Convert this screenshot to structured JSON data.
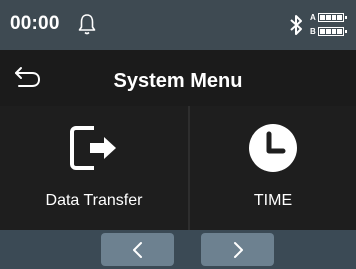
{
  "status_bar": {
    "time": "00:00",
    "icons": [
      "bell-icon",
      "bluetooth-icon",
      "battery-a-icon",
      "battery-b-icon"
    ],
    "battery_labels": [
      "A",
      "B"
    ]
  },
  "header": {
    "title": "System Menu",
    "back_icon": "back-arrow-icon"
  },
  "menu": {
    "items": [
      {
        "label": "Data Transfer",
        "icon": "data-transfer-icon"
      },
      {
        "label": "TIME",
        "icon": "clock-icon"
      }
    ]
  },
  "footer": {
    "prev_icon": "chevron-left-icon",
    "next_icon": "chevron-right-icon"
  },
  "colors": {
    "status_bar_bg": "#3e4a52",
    "background": "#1b1b1b",
    "footer_bg": "#3b4a55",
    "nav_button": "#6d8190"
  }
}
